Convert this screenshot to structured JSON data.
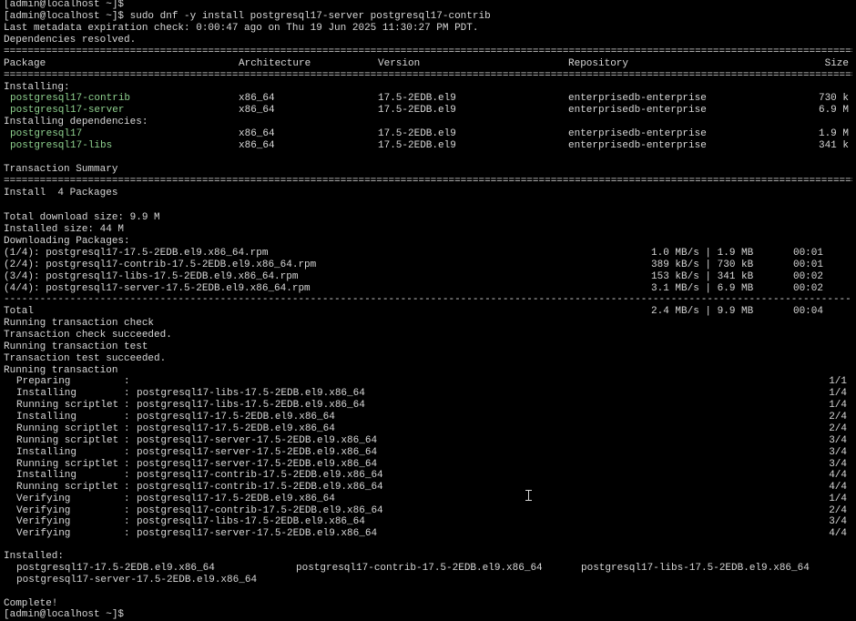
{
  "prompt_prev": "[admin@localhost ~]$",
  "command_line": "[admin@localhost ~]$ sudo dnf -y install postgresql17-server postgresql17-contrib",
  "metadata_line": "Last metadata expiration check: 0:00:47 ago on Thu 19 Jun 2025 11:30:27 PM PDT.",
  "deps_resolved": "Dependencies resolved.",
  "rule_double": "================================================================================================================================================================",
  "rule_single": "----------------------------------------------------------------------------------------------------------------------------------------------------------------",
  "table": {
    "headers": {
      "package": "Package",
      "arch": "Architecture",
      "version": "Version",
      "repo": "Repository",
      "size": "Size"
    },
    "installing_label": "Installing:",
    "deps_label": "Installing dependencies:",
    "rows": [
      {
        "package": "postgresql17-contrib",
        "arch": "x86_64",
        "version": "17.5-2EDB.el9",
        "repo": "enterprisedb-enterprise",
        "size": "730 k"
      },
      {
        "package": "postgresql17-server",
        "arch": "x86_64",
        "version": "17.5-2EDB.el9",
        "repo": "enterprisedb-enterprise",
        "size": "6.9 M"
      },
      {
        "package": "postgresql17",
        "arch": "x86_64",
        "version": "17.5-2EDB.el9",
        "repo": "enterprisedb-enterprise",
        "size": "1.9 M"
      },
      {
        "package": "postgresql17-libs",
        "arch": "x86_64",
        "version": "17.5-2EDB.el9",
        "repo": "enterprisedb-enterprise",
        "size": "341 k"
      }
    ]
  },
  "transaction_summary": "Transaction Summary",
  "install_count": "Install  4 Packages",
  "total_download": "Total download size: 9.9 M",
  "installed_size": "Installed size: 44 M",
  "downloading": "Downloading Packages:",
  "downloads": [
    {
      "file": "(1/4): postgresql17-17.5-2EDB.el9.x86_64.rpm",
      "rate": "1.0 MB/s | 1.9 MB",
      "time": "00:01"
    },
    {
      "file": "(2/4): postgresql17-contrib-17.5-2EDB.el9.x86_64.rpm",
      "rate": "389 kB/s | 730 kB",
      "time": "00:01"
    },
    {
      "file": "(3/4): postgresql17-libs-17.5-2EDB.el9.x86_64.rpm",
      "rate": "153 kB/s | 341 kB",
      "time": "00:02"
    },
    {
      "file": "(4/4): postgresql17-server-17.5-2EDB.el9.x86_64.rpm",
      "rate": "3.1 MB/s | 6.9 MB",
      "time": "00:02"
    }
  ],
  "total": {
    "label": "Total",
    "rate": "2.4 MB/s | 9.9 MB",
    "time": "00:04"
  },
  "checks": [
    "Running transaction check",
    "Transaction check succeeded.",
    "Running transaction test",
    "Transaction test succeeded.",
    "Running transaction"
  ],
  "steps": [
    {
      "action": "Preparing",
      "target": "",
      "progress": "1/1"
    },
    {
      "action": "Installing",
      "target": "postgresql17-libs-17.5-2EDB.el9.x86_64",
      "progress": "1/4"
    },
    {
      "action": "Running scriptlet",
      "target": "postgresql17-libs-17.5-2EDB.el9.x86_64",
      "progress": "1/4"
    },
    {
      "action": "Installing",
      "target": "postgresql17-17.5-2EDB.el9.x86_64",
      "progress": "2/4"
    },
    {
      "action": "Running scriptlet",
      "target": "postgresql17-17.5-2EDB.el9.x86_64",
      "progress": "2/4"
    },
    {
      "action": "Running scriptlet",
      "target": "postgresql17-server-17.5-2EDB.el9.x86_64",
      "progress": "3/4"
    },
    {
      "action": "Installing",
      "target": "postgresql17-server-17.5-2EDB.el9.x86_64",
      "progress": "3/4"
    },
    {
      "action": "Running scriptlet",
      "target": "postgresql17-server-17.5-2EDB.el9.x86_64",
      "progress": "3/4"
    },
    {
      "action": "Installing",
      "target": "postgresql17-contrib-17.5-2EDB.el9.x86_64",
      "progress": "4/4"
    },
    {
      "action": "Running scriptlet",
      "target": "postgresql17-contrib-17.5-2EDB.el9.x86_64",
      "progress": "4/4"
    },
    {
      "action": "Verifying",
      "target": "postgresql17-17.5-2EDB.el9.x86_64",
      "progress": "1/4"
    },
    {
      "action": "Verifying",
      "target": "postgresql17-contrib-17.5-2EDB.el9.x86_64",
      "progress": "2/4"
    },
    {
      "action": "Verifying",
      "target": "postgresql17-libs-17.5-2EDB.el9.x86_64",
      "progress": "3/4"
    },
    {
      "action": "Verifying",
      "target": "postgresql17-server-17.5-2EDB.el9.x86_64",
      "progress": "4/4"
    }
  ],
  "installed_label": "Installed:",
  "installed_items": [
    "postgresql17-17.5-2EDB.el9.x86_64",
    "postgresql17-contrib-17.5-2EDB.el9.x86_64",
    "postgresql17-libs-17.5-2EDB.el9.x86_64",
    "postgresql17-server-17.5-2EDB.el9.x86_64"
  ],
  "complete": "Complete!",
  "prompt_final": "[admin@localhost ~]$",
  "colors": {
    "background": "#000000",
    "text": "#d8d8d8",
    "package_name": "#8fd18f"
  }
}
